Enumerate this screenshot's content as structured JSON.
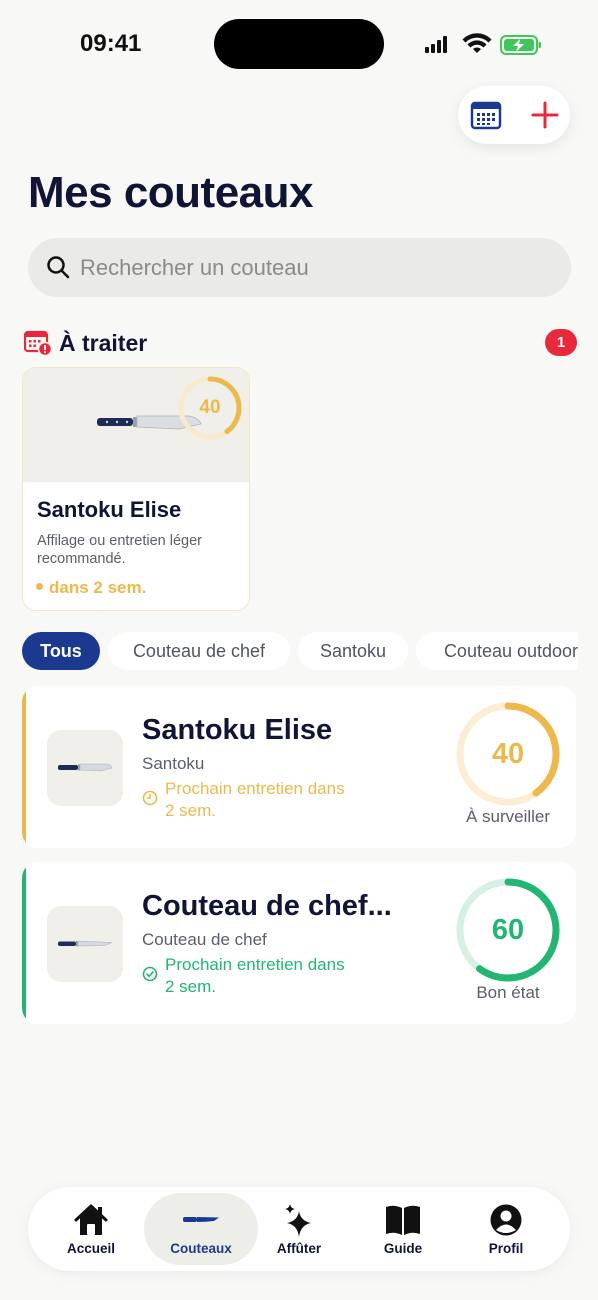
{
  "status_bar": {
    "time": "09:41"
  },
  "header": {
    "title": "Mes couteaux"
  },
  "search": {
    "placeholder": "Rechercher un couteau"
  },
  "todo_section": {
    "title": "À traiter",
    "badge_count": "1",
    "card": {
      "name": "Santoku Elise",
      "score": "40",
      "score_fraction": 0.4,
      "description": "Affilage ou entretien léger recommandé.",
      "due": "dans 2 sem.",
      "accent_color": "#edb84c"
    }
  },
  "filters": [
    "Tous",
    "Couteau de chef",
    "Santoku",
    "Couteau outdoor"
  ],
  "knives": [
    {
      "name": "Santoku Elise",
      "type": "Santoku",
      "next_line1": "Prochain entretien dans",
      "next_line2": "2 sem.",
      "score": "40",
      "score_fraction": 0.4,
      "status": "À surveiller",
      "color": "#edb84c",
      "status_icon": "clock-icon"
    },
    {
      "name": "Couteau de chef...",
      "type": "Couteau de chef",
      "next_line1": "Prochain entretien dans",
      "next_line2": "2 sem.",
      "score": "60",
      "score_fraction": 0.6,
      "status": "Bon état",
      "color": "#22b573",
      "status_icon": "check-circle-icon"
    }
  ],
  "tab_bar": {
    "tabs": [
      {
        "label": "Accueil",
        "icon": "home-icon"
      },
      {
        "label": "Couteaux",
        "icon": "knife-icon"
      },
      {
        "label": "Affûter",
        "icon": "sparkle-icon"
      },
      {
        "label": "Guide",
        "icon": "book-icon"
      },
      {
        "label": "Profil",
        "icon": "profile-icon"
      }
    ],
    "active_index": 1
  },
  "colors": {
    "primary": "#1b3a8f",
    "title": "#101535",
    "warning": "#edb84c",
    "good": "#22b573",
    "danger": "#e8293b",
    "background": "#f8f8f6"
  }
}
